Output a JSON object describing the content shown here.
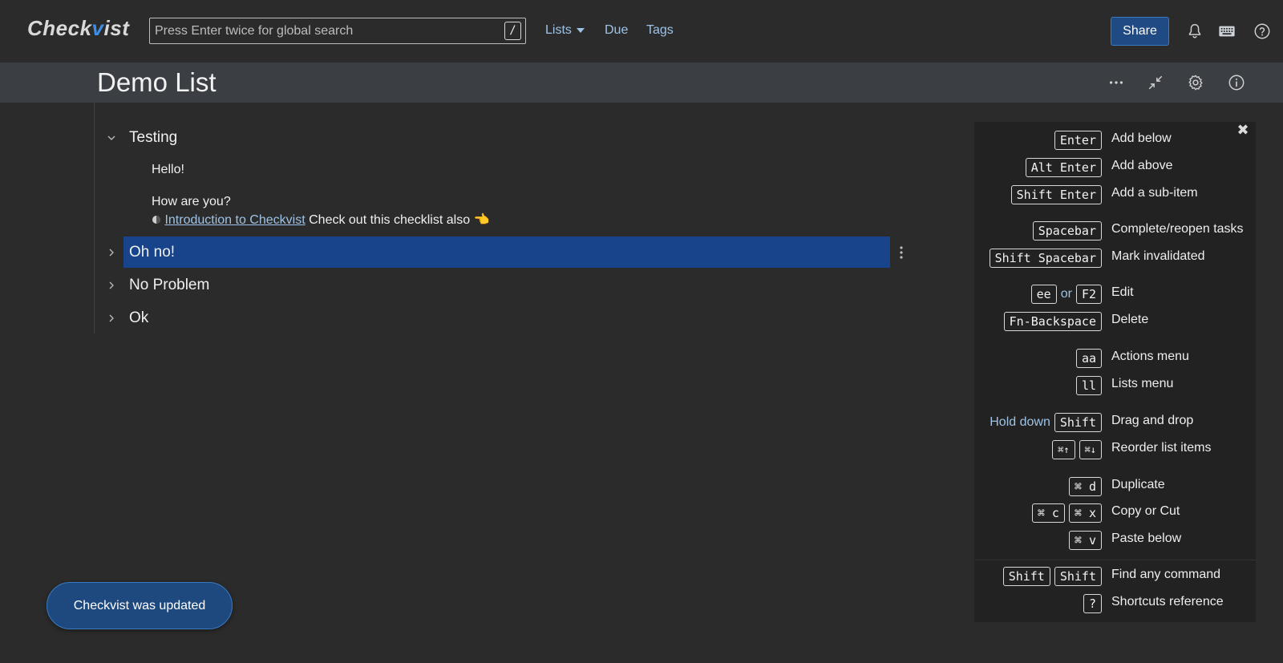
{
  "header": {
    "logo": {
      "pre": "Check",
      "accent": "v",
      "post": "ist"
    },
    "search": {
      "placeholder": "Press Enter twice for global search",
      "shortcut": "/"
    },
    "nav": {
      "lists": "Lists",
      "due": "Due",
      "tags": "Tags"
    },
    "share_label": "Share",
    "icons": [
      "bell-icon",
      "keyboard-icon",
      "help-icon"
    ]
  },
  "titlebar": {
    "title": "Demo List",
    "icons": [
      "more-icon",
      "collapse-icon",
      "gear-icon",
      "info-icon"
    ]
  },
  "outline": {
    "items": [
      {
        "label": "Testing",
        "expanded": true,
        "children": [
          {
            "label": "Hello!"
          },
          {
            "label": "How are you?",
            "link_text": "Introduction to Checkvist",
            "after_link": "Check out this checklist also 👈"
          }
        ]
      },
      {
        "label": "Oh no!",
        "expanded": false,
        "selected": true
      },
      {
        "label": "No Problem",
        "expanded": false
      },
      {
        "label": "Ok",
        "expanded": false
      }
    ]
  },
  "shortcuts": {
    "close": "✖",
    "rows": [
      {
        "keys": [
          "Enter"
        ],
        "desc": "Add below"
      },
      {
        "keys": [
          "Alt Enter"
        ],
        "desc": "Add above"
      },
      {
        "keys": [
          "Shift Enter"
        ],
        "desc": "Add a sub-item"
      },
      {
        "keys": [
          "Spacebar"
        ],
        "desc": "Complete/reopen tasks"
      },
      {
        "keys": [
          "Shift Spacebar"
        ],
        "desc": "Mark invalidated"
      },
      {
        "keys": [
          "ee",
          "F2"
        ],
        "joiner": "or",
        "desc": "Edit"
      },
      {
        "keys": [
          "Fn-Backspace"
        ],
        "desc": "Delete"
      },
      {
        "keys": [
          "aa"
        ],
        "desc": "Actions menu"
      },
      {
        "keys": [
          "ll"
        ],
        "desc": "Lists menu"
      },
      {
        "prefix": "Hold down",
        "keys": [
          "Shift"
        ],
        "desc": "Drag and drop"
      },
      {
        "keys": [
          "⌘↑",
          "⌘↓"
        ],
        "desc": "Reorder list items"
      },
      {
        "keys": [
          "⌘ d"
        ],
        "desc": "Duplicate"
      },
      {
        "keys": [
          "⌘ c",
          "⌘ x"
        ],
        "desc": "Copy or Cut"
      },
      {
        "keys": [
          "⌘ v"
        ],
        "desc": "Paste below"
      },
      {
        "keys": [
          "Shift",
          "Shift"
        ],
        "desc": "Find any command"
      },
      {
        "keys": [
          "?"
        ],
        "desc": "Shortcuts reference"
      }
    ]
  },
  "toast": {
    "message": "Checkvist was updated"
  },
  "colors": {
    "accent": "#3d8fe6",
    "link": "#9ec3e6",
    "selection": "#17448a",
    "share": "#1f4a83"
  }
}
